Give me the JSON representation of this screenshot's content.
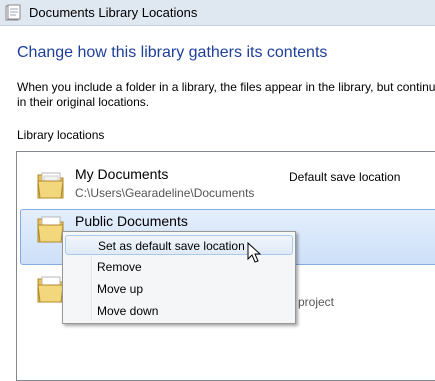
{
  "window": {
    "title": "Documents Library Locations"
  },
  "dialog": {
    "heading": "Change how this library gathers its contents",
    "description_line1": "When you include a folder in a library, the files appear in the library, but continu",
    "description_line2": "in their original locations.",
    "section_label": "Library locations"
  },
  "locations": [
    {
      "name": "My Documents",
      "path": "C:\\Users\\Gearadeline\\Documents",
      "status": "Default save location"
    },
    {
      "name": "Public Documents"
    },
    {
      "partial_path": "project"
    }
  ],
  "context_menu": {
    "items": [
      "Set as default save location",
      "Remove",
      "Move up",
      "Move down"
    ],
    "hovered_index": 0
  },
  "colors": {
    "heading": "#1e3f9a",
    "selection": "#cde0f8",
    "selection_border": "#84acdd",
    "menu_bg": "#f5f6f7"
  }
}
